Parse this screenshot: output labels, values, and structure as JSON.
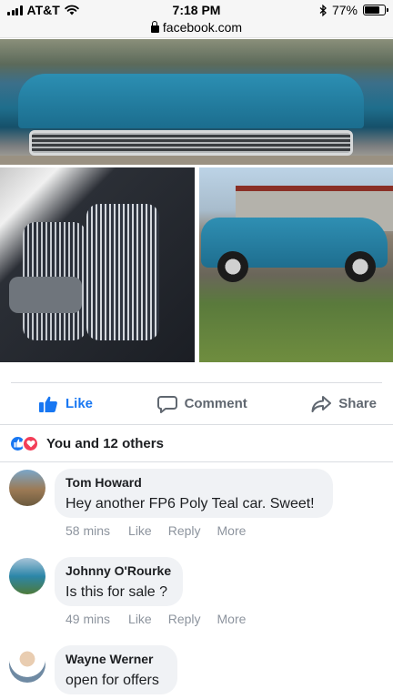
{
  "status_bar": {
    "carrier": "AT&T",
    "time": "7:18 PM",
    "battery_percent": "77%",
    "battery_level": 0.77,
    "icons": [
      "signal-icon",
      "wifi-icon",
      "bluetooth-icon",
      "battery-icon"
    ]
  },
  "browser": {
    "url": "facebook.com"
  },
  "actions": {
    "like": "Like",
    "comment": "Comment",
    "share": "Share"
  },
  "reactions": {
    "summary": "You and 12 others",
    "types": [
      "like",
      "love"
    ],
    "colors": {
      "like": "#1877f2",
      "love": "#f33e58"
    }
  },
  "comments": [
    {
      "author": "Tom Howard",
      "text": "Hey another FP6 Poly Teal car. Sweet!",
      "time": "58 mins",
      "like_label": "Like",
      "reply_label": "Reply",
      "more_label": "More"
    },
    {
      "author": "Johnny O'Rourke",
      "text": "Is this for sale ?",
      "time": "49 mins",
      "like_label": "Like",
      "reply_label": "Reply",
      "more_label": "More"
    },
    {
      "author": "Wayne Werner",
      "text": "open for offers"
    }
  ],
  "colors": {
    "accent": "#1877f2",
    "muted_text": "#8d949e",
    "bubble_bg": "#f0f2f5"
  }
}
